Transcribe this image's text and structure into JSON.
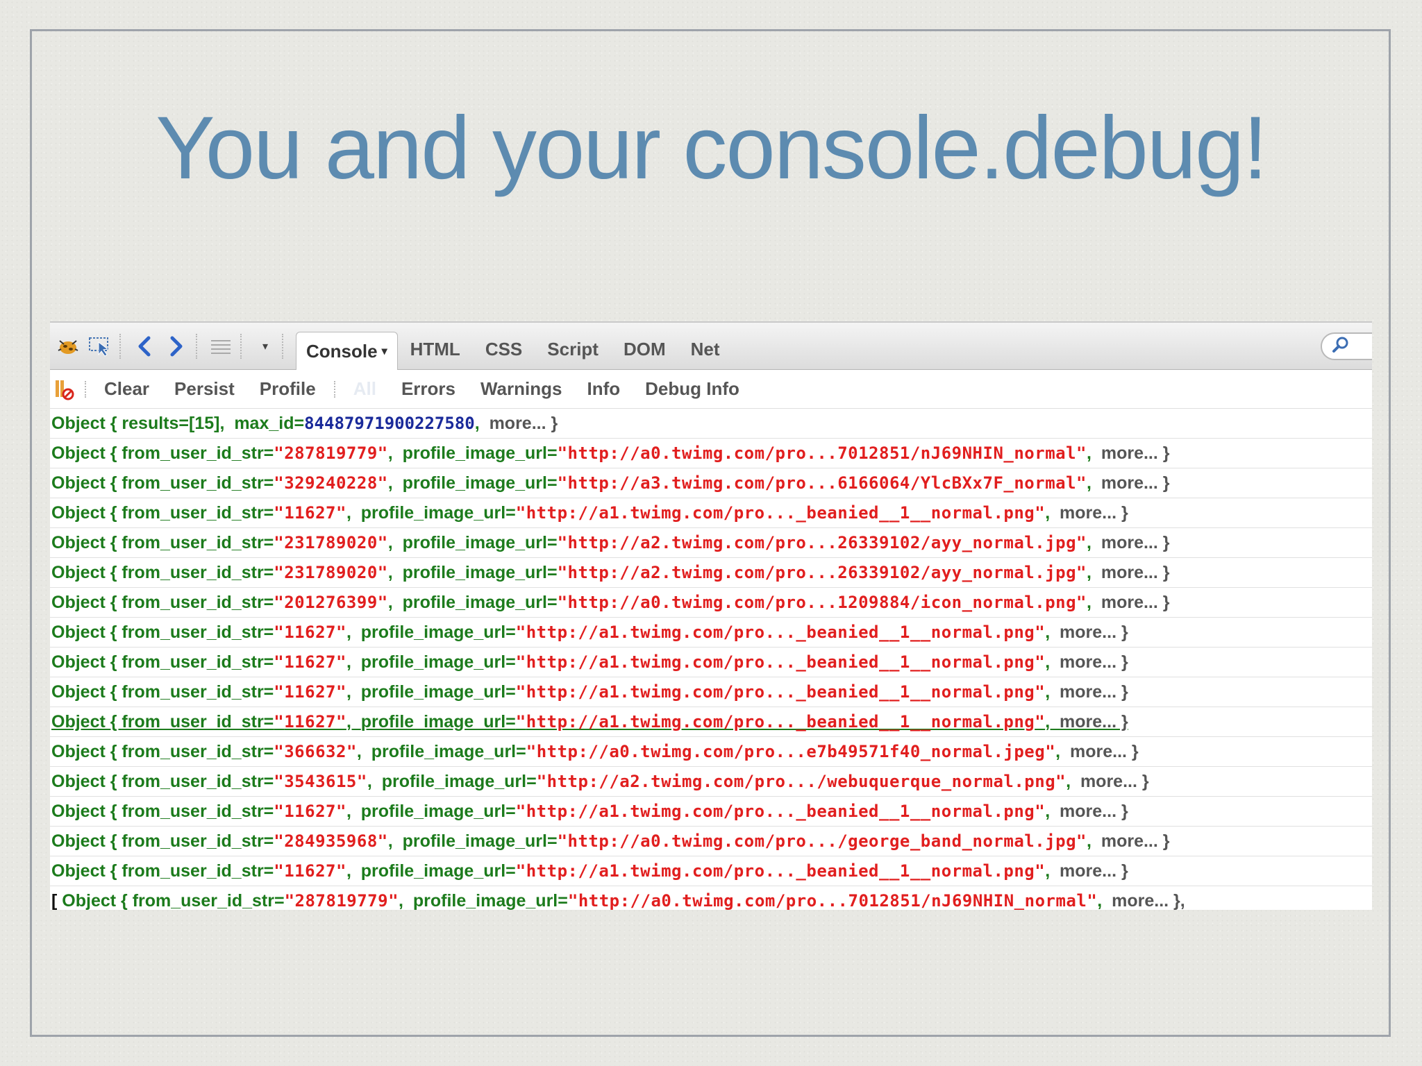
{
  "slide": {
    "title": "You and your console.debug!"
  },
  "toolbar": {
    "tabs": [
      {
        "label": "Console",
        "active": true
      },
      {
        "label": "HTML"
      },
      {
        "label": "CSS"
      },
      {
        "label": "Script"
      },
      {
        "label": "DOM"
      },
      {
        "label": "Net"
      }
    ],
    "caret": "▾",
    "dropdown_arrow": "▾"
  },
  "filters": [
    {
      "label": "Clear"
    },
    {
      "label": "Persist"
    },
    {
      "label": "Profile"
    },
    {
      "label": "All",
      "selected": true
    },
    {
      "label": "Errors"
    },
    {
      "label": "Warnings"
    },
    {
      "label": "Info"
    },
    {
      "label": "Debug Info"
    }
  ],
  "console": {
    "first": {
      "prefix": "Object { ",
      "key1": "results=",
      "val1": "[15]",
      "sep": ",  ",
      "key2": "max_id=",
      "val2": "84487971900227580",
      "tail": ",  ",
      "more": "more... }"
    },
    "rows": [
      {
        "uid": "287819779",
        "url": "http://a0.twimg.com/pro...7012851/nJ69NHIN_normal"
      },
      {
        "uid": "329240228",
        "url": "http://a3.twimg.com/pro...6166064/YlcBXx7F_normal"
      },
      {
        "uid": "11627",
        "url": "http://a1.twimg.com/pro..._beanied__1__normal.png"
      },
      {
        "uid": "231789020",
        "url": "http://a2.twimg.com/pro...26339102/ayy_normal.jpg"
      },
      {
        "uid": "231789020",
        "url": "http://a2.twimg.com/pro...26339102/ayy_normal.jpg"
      },
      {
        "uid": "201276399",
        "url": "http://a0.twimg.com/pro...1209884/icon_normal.png"
      },
      {
        "uid": "11627",
        "url": "http://a1.twimg.com/pro..._beanied__1__normal.png"
      },
      {
        "uid": "11627",
        "url": "http://a1.twimg.com/pro..._beanied__1__normal.png"
      },
      {
        "uid": "11627",
        "url": "http://a1.twimg.com/pro..._beanied__1__normal.png"
      },
      {
        "uid": "11627",
        "url": "http://a1.twimg.com/pro..._beanied__1__normal.png",
        "underlined": true
      },
      {
        "uid": "366632",
        "url": "http://a0.twimg.com/pro...e7b49571f40_normal.jpeg"
      },
      {
        "uid": "3543615",
        "url": "http://a2.twimg.com/pro.../webuquerque_normal.png"
      },
      {
        "uid": "11627",
        "url": "http://a1.twimg.com/pro..._beanied__1__normal.png"
      },
      {
        "uid": "284935968",
        "url": "http://a0.twimg.com/pro.../george_band_normal.jpg"
      },
      {
        "uid": "11627",
        "url": "http://a1.twimg.com/pro..._beanied__1__normal.png"
      }
    ],
    "row_text": {
      "prefix": "Object { ",
      "key1": "from_user_id_str=",
      "key2": "profile_image_url=",
      "sep": ",  ",
      "more": "more... }"
    },
    "last": {
      "bracket": "[ ",
      "prefix": "Object { ",
      "key1": "from_user_id_str=",
      "uid": "287819779",
      "sep": ",  ",
      "key2": "profile_image_url=",
      "url": "http://a0.twimg.com/pro...7012851/nJ69NHIN_normal",
      "more": "more... },"
    }
  },
  "colors": {
    "title": "#5d8bb0",
    "object_green": "#1c7b1c",
    "string_red": "#e11e1e",
    "number_blue": "#1a2a9a"
  },
  "icons": [
    "firebug-icon",
    "inspect-icon",
    "back-icon",
    "forward-icon",
    "menu-icon",
    "dropdown-icon",
    "search-icon",
    "console-clear-icon"
  ]
}
